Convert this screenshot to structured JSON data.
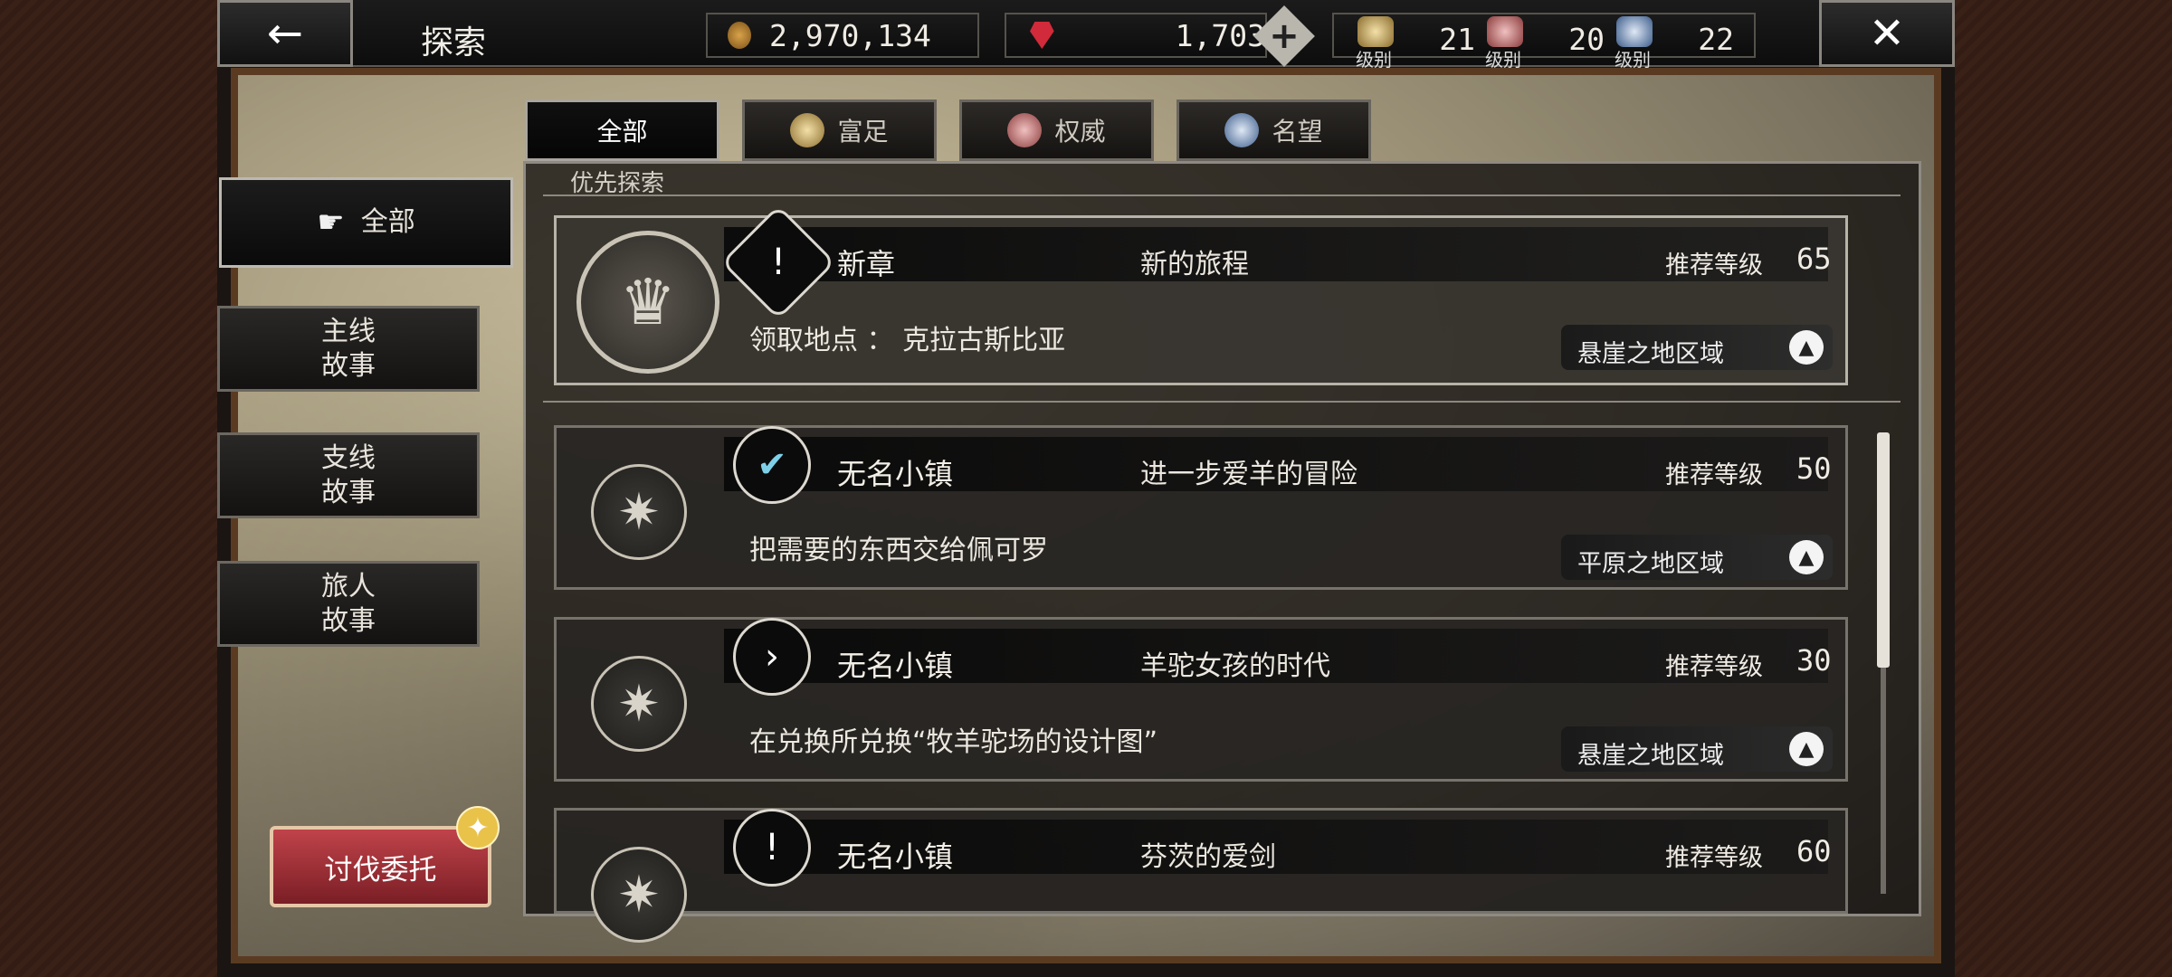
{
  "header": {
    "title": "探索",
    "back_icon": "←",
    "close_icon": "✕"
  },
  "currency": {
    "coins": "2,970,134",
    "gems": "1,703",
    "add_gems_icon": "+"
  },
  "ranks": [
    {
      "name": "wealth",
      "label": "级别",
      "value": "21"
    },
    {
      "name": "power",
      "label": "级别",
      "value": "20"
    },
    {
      "name": "fame",
      "label": "级别",
      "value": "22"
    }
  ],
  "tabs": [
    {
      "label": "全部",
      "active": true
    },
    {
      "label": "富足"
    },
    {
      "label": "权威"
    },
    {
      "label": "名望"
    }
  ],
  "sidebar": {
    "all": "全部",
    "main_story": "主线\n故事",
    "side_story": "支线\n故事",
    "traveler_story": "旅人\n故事"
  },
  "subjugation_button": "讨伐委托",
  "priority_label": "优先探索",
  "recommend_label": "推荐等级",
  "quests": [
    {
      "location": "新章",
      "title": "新的旅程",
      "level": "65",
      "description": "领取地点 ： 克拉古斯比亚",
      "region": "悬崖之地区域",
      "status": "!"
    },
    {
      "location": "无名小镇",
      "title": "进一步爱羊的冒险",
      "level": "50",
      "description": "把需要的东西交给佩可罗",
      "region": "平原之地区域",
      "status": "✔"
    },
    {
      "location": "无名小镇",
      "title": "羊驼女孩的时代",
      "level": "30",
      "description": "在兑换所兑换“牧羊驼场的设计图”",
      "region": "悬崖之地区域",
      "status": "›"
    },
    {
      "location": "无名小镇",
      "title": "芬茨的爱剑",
      "level": "60",
      "description": "",
      "region": "",
      "status": "!"
    }
  ],
  "colors": {
    "accent_red": "#b8323a",
    "panel_border": "#8e8a83",
    "check_color": "#7ed0e8"
  }
}
